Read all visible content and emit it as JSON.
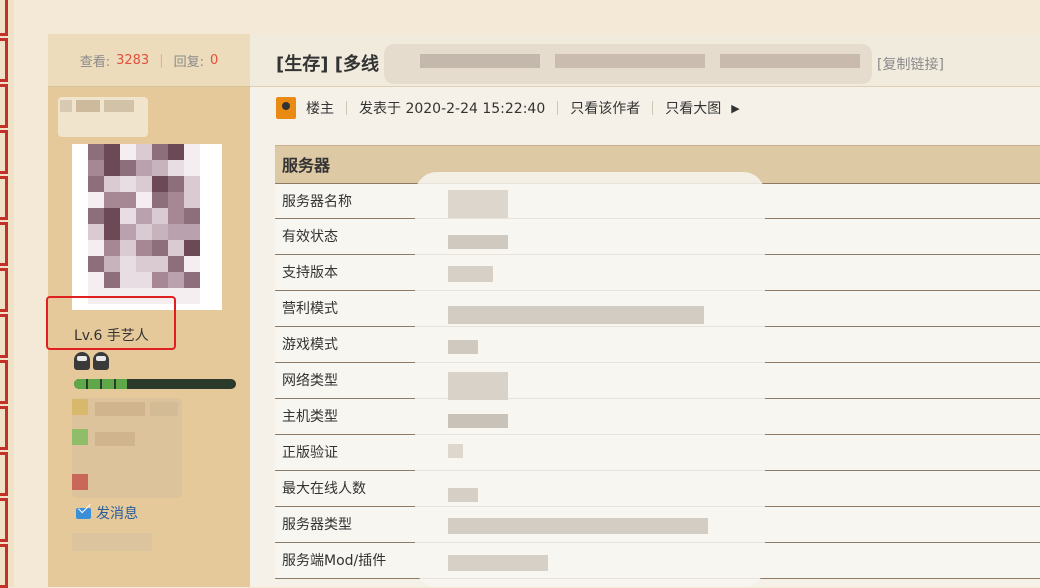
{
  "stats": {
    "views_label": "查看:",
    "views": "3283",
    "replies_label": "回复:",
    "replies": "0"
  },
  "thread": {
    "title": "[生存] [多线",
    "copy_link": "[复制链接]"
  },
  "post_meta": {
    "author_role": "楼主",
    "posted": "发表于 2020-2-24 15:22:40",
    "only_author": "只看该作者",
    "large_images": "只看大图"
  },
  "user": {
    "level": "Lv.6 手艺人",
    "send_message": "发消息"
  },
  "colors": {
    "accent": "#e0503a",
    "highlight_box": "#e02020",
    "link": "#2a5d9a",
    "side_bg": "#e5c99b"
  },
  "table": {
    "header": "服务器",
    "rows": [
      "服务器名称",
      "有效状态",
      "支持版本",
      "营利模式",
      "游戏模式",
      "网络类型",
      "主机类型",
      "正版验证",
      "最大在线人数",
      "服务器类型",
      "服务端Mod/插件"
    ]
  }
}
